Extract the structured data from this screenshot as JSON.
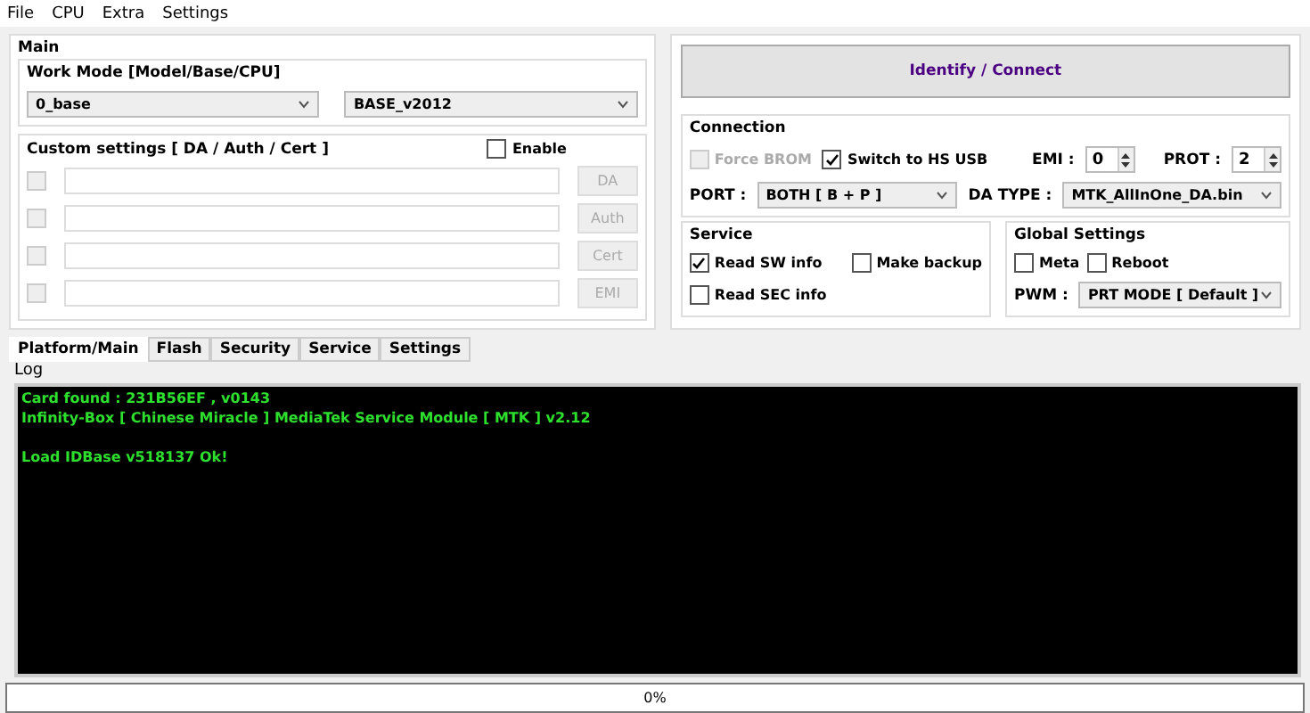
{
  "menu": [
    "File",
    "CPU",
    "Extra",
    "Settings"
  ],
  "main": {
    "title": "Main",
    "work_mode": {
      "title": "Work Mode [Model/Base/CPU]",
      "model": "0_base",
      "base": "BASE_v2012"
    },
    "custom": {
      "title": "Custom settings [ DA / Auth / Cert ]",
      "enable": {
        "label": "Enable",
        "checked": false
      },
      "rows": [
        {
          "button": "DA",
          "disabled": true
        },
        {
          "button": "Auth",
          "disabled": true
        },
        {
          "button": "Cert",
          "disabled": true
        },
        {
          "button": "EMI",
          "disabled": true
        }
      ]
    }
  },
  "identify": "Identify / Connect",
  "connection": {
    "title": "Connection",
    "force_brom": {
      "label": "Force BROM",
      "checked": false,
      "disabled": true
    },
    "hs_usb": {
      "label": "Switch to HS USB",
      "checked": true,
      "disabled": false
    },
    "emi": {
      "label": "EMI :",
      "value": "0"
    },
    "prot": {
      "label": "PROT :",
      "value": "2"
    },
    "port": {
      "label": "PORT :",
      "value": "BOTH [ B + P ]"
    },
    "da_type": {
      "label": "DA TYPE :",
      "value": "MTK_AllInOne_DA.bin"
    }
  },
  "service": {
    "title": "Service",
    "options": [
      {
        "label": "Read SW info",
        "checked": true
      },
      {
        "label": "Make backup",
        "checked": false
      },
      {
        "label": "Read SEC info",
        "checked": false
      }
    ]
  },
  "global": {
    "title": "Global Settings",
    "options": [
      {
        "label": "Meta",
        "checked": false
      },
      {
        "label": "Reboot",
        "checked": false
      }
    ],
    "pwm": {
      "label": "PWM :",
      "value": "PRT MODE [ Default ]"
    }
  },
  "tabs": [
    {
      "label": "Platform/Main",
      "selected": true
    },
    {
      "label": "Flash",
      "selected": false
    },
    {
      "label": "Security",
      "selected": false
    },
    {
      "label": "Service",
      "selected": false
    },
    {
      "label": "Settings",
      "selected": false
    }
  ],
  "log": {
    "label": "Log",
    "blocks": [
      [
        "Card found : 231B56EF , v0143",
        "Infinity-Box [ Chinese Miracle ] MediaTek Service Module [ MTK ] v2.12"
      ],
      [
        "Load IDBase v518137 Ok!"
      ]
    ]
  },
  "progress": {
    "text": "0%",
    "level": 0
  }
}
